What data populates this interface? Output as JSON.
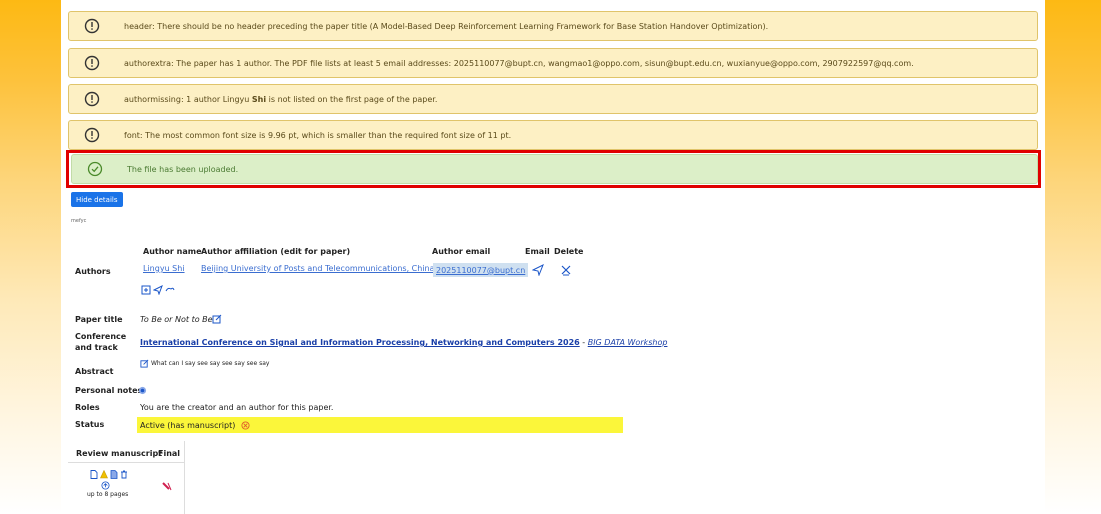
{
  "alerts": [
    {
      "text": "header: There should be no header preceding the paper title (A Model-Based Deep Reinforcement Learning Framework for Base Station Handover Optimization)."
    },
    {
      "text": "authorextra: The paper has 1 author. The PDF file lists at least 5 email addresses: 2025110077@bupt.cn, wangmao1@oppo.com, sisun@bupt.edu.cn, wuxianyue@oppo.com, 2907922597@qq.com."
    },
    {
      "text_prefix": "authormissing: 1 author Lingyu ",
      "text_bold": "Shi",
      "text_suffix": " is not listed on the first page of the paper."
    },
    {
      "text": "font: The most common font size is 9.96 pt, which is smaller than the required font size of 11 pt."
    }
  ],
  "success_alert": {
    "text": "The file has been uploaded."
  },
  "hide_details_label": "Hide details",
  "tiny_note": "mefyc",
  "authors_table": {
    "section_label": "Authors",
    "headers": {
      "name": "Author name",
      "affiliation": "Author affiliation (edit for paper)",
      "email": "Author email",
      "email_action": "Email",
      "delete": "Delete"
    },
    "rows": [
      {
        "name": "Lingyu Shi",
        "affiliation": "Beijing University of Posts and Telecommunications, China",
        "email": "2025110077@bupt.cn"
      }
    ]
  },
  "paper": {
    "title_label": "Paper title",
    "title_value": "To Be or Not to Be",
    "conference_label_1": "Conference",
    "conference_label_2": "and track",
    "conference_name": "International Conference on Signal and Information Processing, Networking and Computers 2026",
    "conference_sep": " - ",
    "track_name": "BIG DATA Workshop",
    "abstract_label": "Abstract",
    "abstract_value": "What can I say see say see say see say",
    "notes_label": "Personal notes",
    "roles_label": "Roles",
    "roles_value": "You are the creator and an author for this paper.",
    "status_label": "Status",
    "status_value": "Active (has manuscript)",
    "status_color": "#fbf63a"
  },
  "review": {
    "header_review": "Review manuscript",
    "header_final": "Final",
    "page_limit": "up to 8 pages"
  },
  "colors": {
    "warning_bg": "#fdf0c4",
    "success_bg": "#dcefc8",
    "highlight_border": "#e00000",
    "button_blue": "#1a73e8",
    "page_bg_orange": "#fdb913"
  },
  "icons": [
    "warning-circle-icon",
    "check-circle-icon",
    "send-icon",
    "delete-x-icon",
    "add-icon",
    "edit-icon",
    "link-icon",
    "notes-icon",
    "cancel-icon",
    "document-icon",
    "alert-icon",
    "upload-icon",
    "trash-icon",
    "no-final-icon"
  ]
}
